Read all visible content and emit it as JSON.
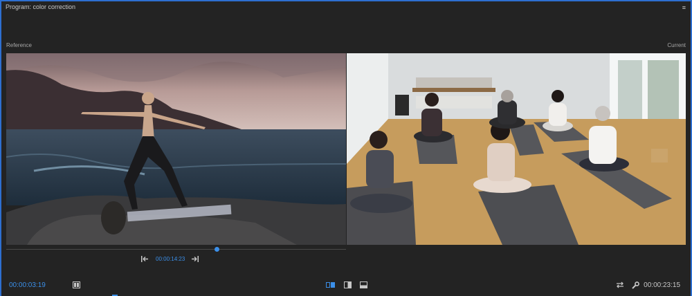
{
  "panel": {
    "title": "Program: color correction",
    "menu_glyph": "≡",
    "reference_label": "Reference",
    "current_label": "Current"
  },
  "reference_player": {
    "timecode": "00:00:14:23",
    "controls": [
      "step-back-icon",
      "step-forward-icon"
    ],
    "playhead_position": 0.62
  },
  "footer": {
    "current_timecode": "00:00:03:19",
    "duration_timecode": "00:00:23:15",
    "icons": [
      "settings-book-icon",
      "side-by-side-icon",
      "vertical-split-icon",
      "horizontal-split-icon",
      "swap-icon",
      "wrench-icon"
    ]
  },
  "colors": {
    "accent": "#3b8fe9",
    "panel_border": "#2d6fd0",
    "background": "#232323"
  }
}
